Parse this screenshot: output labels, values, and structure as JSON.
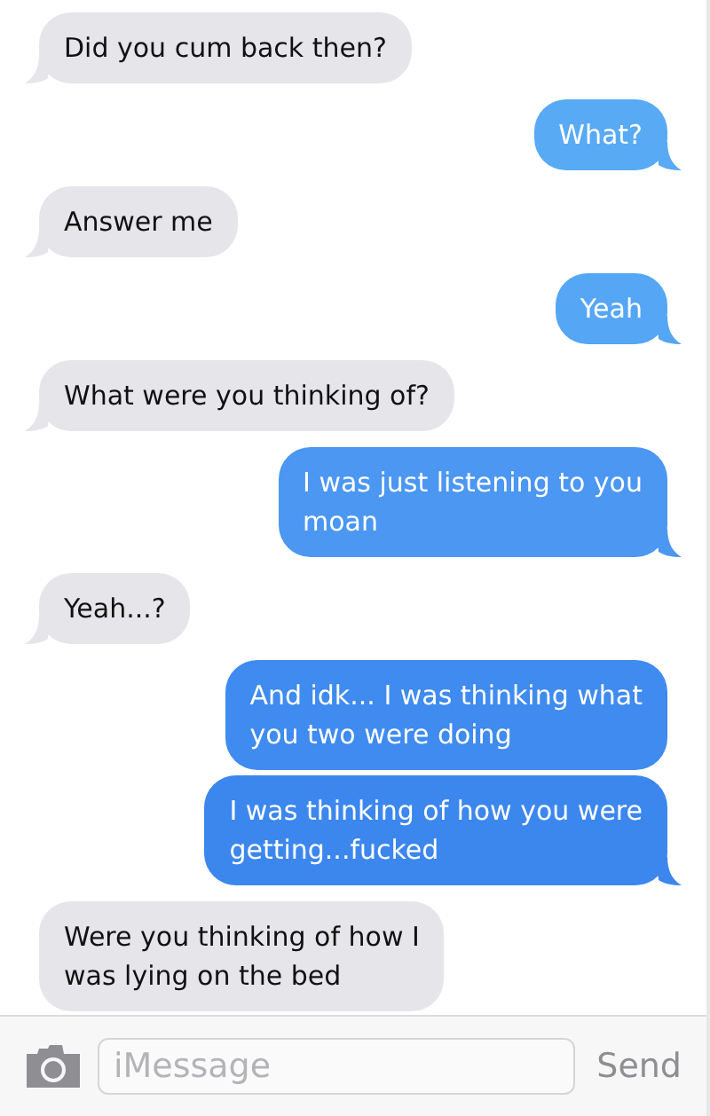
{
  "messages": [
    {
      "kind": "received",
      "text": "Did you cum back then?",
      "tail": true
    },
    {
      "kind": "sent",
      "text": "What?",
      "tail": true,
      "color": "#58aaf5"
    },
    {
      "kind": "received",
      "text": "Answer me",
      "tail": true
    },
    {
      "kind": "sent",
      "text": "Yeah",
      "tail": true,
      "color": "#55a6f5"
    },
    {
      "kind": "received",
      "text": "What were you thinking of?",
      "tail": true
    },
    {
      "kind": "sent",
      "text": "I was just listening to you\nmoan",
      "tail": true,
      "color": "#4b97f2"
    },
    {
      "kind": "received",
      "text": "Yeah...?",
      "tail": true
    },
    {
      "kind": "sent",
      "text": "And idk... I was thinking what\nyou two were doing",
      "tail": false,
      "color": "#3f8bef"
    },
    {
      "kind": "sent",
      "text": "I was thinking of how you were\ngetting...fucked",
      "tail": true,
      "color": "#3c87ee"
    },
    {
      "kind": "received",
      "text": "Were you thinking of how I\nwas lying on the bed",
      "tail": false
    }
  ],
  "composer": {
    "placeholder": "iMessage",
    "send": {
      "label": "Send",
      "disabled": true
    }
  }
}
